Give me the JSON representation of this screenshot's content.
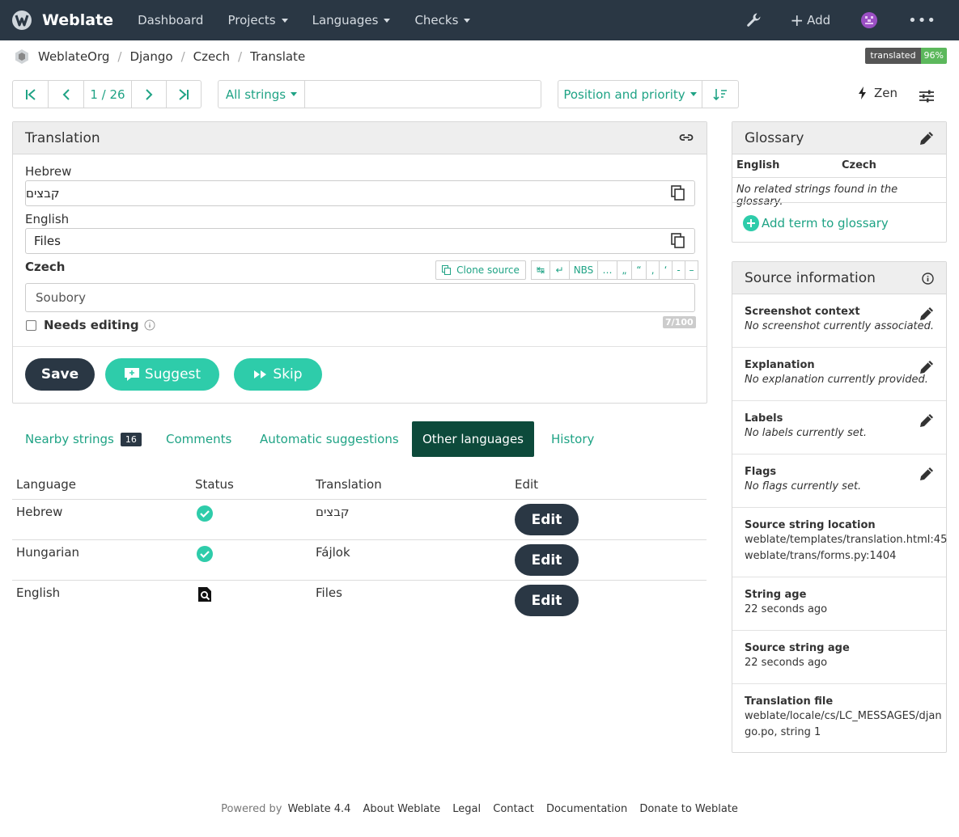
{
  "nav": {
    "brand": "Weblate",
    "items": [
      "Dashboard",
      "Projects",
      "Languages",
      "Checks"
    ],
    "add_label": "Add"
  },
  "breadcrumb": [
    "WeblateOrg",
    "Django",
    "Czech",
    "Translate"
  ],
  "status": {
    "label": "translated",
    "percent": "96%"
  },
  "toolbar": {
    "position": "1 / 26",
    "filter": "All strings",
    "search_value": "",
    "sort": "Position and priority",
    "zen": "Zen"
  },
  "translation": {
    "title": "Translation",
    "hebrew_label": "Hebrew",
    "hebrew_value": "קבצים",
    "english_label": "English",
    "english_value": "Files",
    "czech_label": "Czech",
    "clone_source": "Clone source",
    "special_chars": [
      "↹",
      "↵",
      "NBS",
      "…",
      "„",
      "“",
      "‚",
      "‘",
      "-",
      "–"
    ],
    "czech_value": "Soubory",
    "needs_editing": "Needs editing",
    "counter": "7/100",
    "save": "Save",
    "suggest": "Suggest",
    "skip": "Skip"
  },
  "tabs": [
    {
      "label": "Nearby strings",
      "count": "16"
    },
    {
      "label": "Comments"
    },
    {
      "label": "Automatic suggestions"
    },
    {
      "label": "Other languages"
    },
    {
      "label": "History"
    }
  ],
  "table": {
    "headers": [
      "Language",
      "Status",
      "Translation",
      "Edit"
    ],
    "rows": [
      {
        "language": "Hebrew",
        "status": "translated",
        "translation": "קבצים",
        "edit": "Edit"
      },
      {
        "language": "Hungarian",
        "status": "translated",
        "translation": "Fájlok",
        "edit": "Edit"
      },
      {
        "language": "English",
        "status": "source",
        "translation": "Files",
        "edit": "Edit"
      }
    ]
  },
  "glossary": {
    "title": "Glossary",
    "col_source": "English",
    "col_target": "Czech",
    "empty": "No related strings found in the glossary.",
    "add": "Add term to glossary"
  },
  "source_info": {
    "title": "Source information",
    "items": [
      {
        "title": "Screenshot context",
        "value": "No screenshot currently associated."
      },
      {
        "title": "Explanation",
        "value": "No explanation currently provided."
      },
      {
        "title": "Labels",
        "value": "No labels currently set."
      },
      {
        "title": "Flags",
        "value": "No flags currently set."
      },
      {
        "title": "Source string location",
        "links": [
          "weblate/templates/translation.html:45",
          "weblate/trans/forms.py:1404"
        ]
      },
      {
        "title": "String age",
        "value": "22 seconds ago"
      },
      {
        "title": "Source string age",
        "value": "22 seconds ago"
      },
      {
        "title": "Translation file",
        "value_line1": "weblate/locale/cs/LC_MESSAGES/djan",
        "value_line2": "go.po, string 1"
      }
    ]
  },
  "footer": {
    "powered": "Powered by",
    "version": "Weblate 4.4",
    "links": [
      "About Weblate",
      "Legal",
      "Contact",
      "Documentation",
      "Donate to Weblate"
    ]
  },
  "colors": {
    "navbar": "#2a3744",
    "accent": "#1fa385",
    "suggest": "#2eccaa",
    "badge_green": "#5cb85c"
  }
}
